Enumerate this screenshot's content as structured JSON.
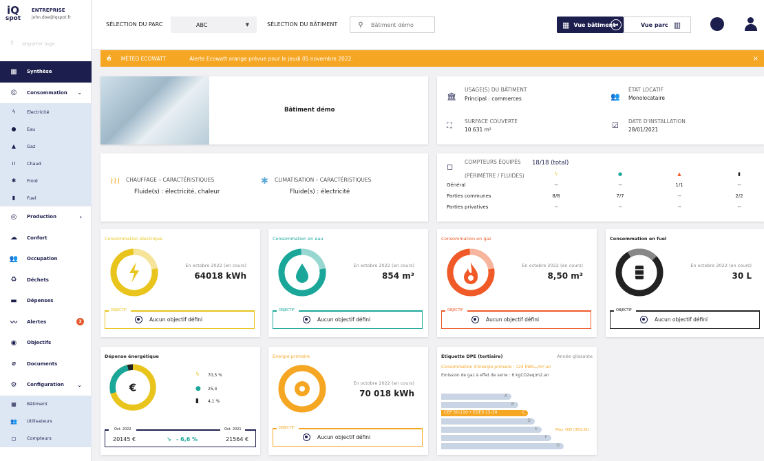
{
  "brand": {
    "logo_top": "iQ",
    "logo_bottom": "spot",
    "company": "ENTREPRISE",
    "email": "john.doe@iqspot.fr",
    "upload": "Importer logo"
  },
  "nav": {
    "synthese": "Synthèse",
    "consommation": "Consommation",
    "conso_sub": [
      "Electricité",
      "Eau",
      "Gaz",
      "Chaud",
      "Froid",
      "Fuel"
    ],
    "production": "Production",
    "confort": "Confort",
    "occupation": "Occupation",
    "dechets": "Déchets",
    "depenses": "Dépenses",
    "alertes": "Alertes",
    "alertes_count": "3",
    "objectifs": "Objectifs",
    "documents": "Documents",
    "configuration": "Configuration",
    "config_sub": [
      "Bâtiment",
      "Utilisateurs",
      "Compteurs"
    ]
  },
  "topbar": {
    "parc_label": "SÉLECTION DU PARC",
    "parc_value": "ABC",
    "bat_label": "SÉLECTION DU BÂTIMENT",
    "bat_placeholder": "Bâtiment démo",
    "vue_batiment": "Vue bâtiment",
    "vue_parc": "Vue parc"
  },
  "alert": {
    "title": "MÉTÉO ECOWATT",
    "message": "Alerte Ecowatt orange prévue pour le jeudi 05 novembre 2022.",
    "close": "×"
  },
  "building": {
    "name": "Bâtiment démo",
    "usage_label": "USAGE(S) DU BÂTIMENT",
    "usage_value": "Principal : commerces",
    "surface_label": "SURFACE COUVERTE",
    "surface_value": "10 631 m²",
    "etat_label": "ÉTAT LOCATIF",
    "etat_value": "Monolocataire",
    "date_label": "DATE D'INSTALLATION",
    "date_value": "28/01/2021"
  },
  "characteristics": {
    "chauffage_label": "CHAUFFAGE – CARACTÉRISTIQUES",
    "chauffage_value": "Fluide(s) : électricité, chaleur",
    "clim_label": "CLIMATISATION – CARACTÉRISTIQUES",
    "clim_value": "Fluide(s) : électricité"
  },
  "meters": {
    "title": "COMPTEURS ÉQUIPÉS",
    "subtitle": "(PÉRIMÈTRE / FLUIDES)",
    "total": "18/18 (total)",
    "rows": [
      {
        "label": "Général",
        "values": [
          "--",
          "--",
          "1/1",
          "--"
        ]
      },
      {
        "label": "Parties communes",
        "values": [
          "8/8",
          "7/7",
          "--",
          "2/2"
        ]
      },
      {
        "label": "Parties privatives",
        "values": [
          "--",
          "--",
          "--",
          "--"
        ]
      }
    ]
  },
  "kpis": [
    {
      "title": "Consommation électrique",
      "sub": "En octobre 2022 (en cours)",
      "value": "64018 kWh",
      "objective_label": "OBJECTIF",
      "objective": "Aucun objectif défini",
      "color": "#e8c41c"
    },
    {
      "title": "Consommation en eau",
      "sub": "En octobre 2022 (en cours)",
      "value": "854 m³",
      "objective_label": "OBJECTIF",
      "objective": "Aucun objectif défini",
      "color": "#1aa79a"
    },
    {
      "title": "Consommation en gaz",
      "sub": "En octobre 2022 (en cours)",
      "value": "8,50 m³",
      "objective_label": "OBJECTIF",
      "objective": "Aucun objectif défini",
      "color": "#ef5a28"
    },
    {
      "title": "Consommation en fuel",
      "sub": "En octobre 2022 (en cours)",
      "value": "30 L",
      "objective_label": "OBJECTIF",
      "objective": "Aucun objectif défini",
      "color": "#222222"
    }
  ],
  "depense": {
    "title": "Dépense énergétique",
    "elec": "70,5 %",
    "eau": "25,4",
    "fuel": "4,1 %",
    "prev_label": "Oct. 2022",
    "prev_value": "20145 €",
    "cur_label": "Oct. 2021",
    "cur_value": "21564 €",
    "delta": "- 6,6 %",
    "currency": "€"
  },
  "primaire": {
    "title": "Energie primaire",
    "sub": "En octobre 2022 (en cours)",
    "value": "70 018 kWh",
    "objective_label": "OBJECTIF",
    "objective": "Aucun objectif défini"
  },
  "dpe": {
    "title": "Étiquette DPE (tertiaire)",
    "period": "Année glissante",
    "line1": "Consommation d'énergie primaire : 124 kWhₑₚ/m².an",
    "line2": "Emission de gaz à effet de serre : 6 kgCO2eq/m2.an",
    "classes": [
      "A",
      "B",
      "CEP 50-110 • EGES 15-30",
      "C",
      "D",
      "E",
      "F",
      "G"
    ],
    "moy": "Moy. OID (363,81)"
  }
}
